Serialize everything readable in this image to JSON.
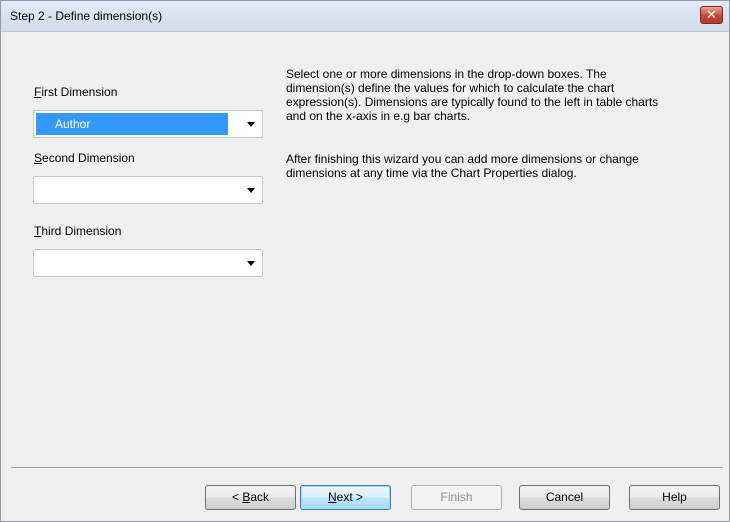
{
  "window": {
    "title": "Step 2 - Define dimension(s)",
    "close_glyph": "✕"
  },
  "dimensions": {
    "first": {
      "label_underline": "F",
      "label_rest": "irst Dimension",
      "value": "Author"
    },
    "second": {
      "label_underline": "S",
      "label_rest": "econd Dimension",
      "value": ""
    },
    "third": {
      "label_underline": "T",
      "label_rest": "hird Dimension",
      "value": ""
    }
  },
  "description": {
    "line1": "Select one or more dimensions in the drop-down boxes. The",
    "line2": "dimension(s) define the values for which to calculate the chart",
    "line3": "expression(s). Dimensions are typically found to the left in table charts",
    "line4": "and on the x-axis in e.g bar charts.",
    "line5": "After finishing this wizard you can add more dimensions or change",
    "line6": "dimensions at any time via the Chart Properties dialog."
  },
  "buttons": {
    "back": {
      "prefix": "< ",
      "underline": "B",
      "rest": "ack"
    },
    "next": {
      "underline": "N",
      "rest": "ext >"
    },
    "finish": "Finish",
    "cancel": "Cancel",
    "help": "Help"
  }
}
